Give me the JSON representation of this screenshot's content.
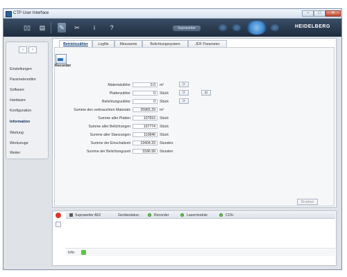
{
  "window": {
    "title": "CTP User Interface"
  },
  "window_controls": {
    "minimize": "–",
    "maximize": "□",
    "close": "✕"
  },
  "toolbar": {
    "device_label": "Suprasetter",
    "brand": "HEIDELBERG",
    "icons": [
      "pages-icon",
      "print-icon",
      "wrench-icon",
      "tools-icon",
      "info-icon",
      "help-icon"
    ]
  },
  "sidebar": {
    "nav_back": "‹",
    "nav_forward": "›",
    "items": [
      {
        "label": "Einstellungen",
        "active": false
      },
      {
        "label": "Parametereditor",
        "active": false
      },
      {
        "label": "Software",
        "active": false
      },
      {
        "label": "Hardware",
        "active": false
      },
      {
        "label": "Konfiguration",
        "active": false
      },
      {
        "label": "Information",
        "active": true
      },
      {
        "label": "Wartung",
        "active": false
      },
      {
        "label": "Werkzeuge",
        "active": false
      },
      {
        "label": "Weiter",
        "active": false
      }
    ]
  },
  "tabs": [
    {
      "label": "Betriebszähler",
      "active": true
    },
    {
      "label": "Logfile",
      "active": false
    },
    {
      "label": "Messwerte",
      "active": false
    },
    {
      "label": "Belichtungssystem",
      "active": false
    },
    {
      "label": "JDF Parameter",
      "active": false
    }
  ],
  "recorder": {
    "label": "Recorder",
    "rows": [
      {
        "label": "Materialzähler",
        "value": "0.0",
        "unit": "m²"
      },
      {
        "label": "Plattenzähler",
        "value": "0",
        "unit": "Stück"
      },
      {
        "label": "Belichtungszähler",
        "value": "0",
        "unit": "Stück"
      },
      {
        "label": "Summe des verbrauchten Materials",
        "value": "25965.29",
        "unit": "m²"
      },
      {
        "label": "Summe aller Platten",
        "value": "107816",
        "unit": "Stück"
      },
      {
        "label": "Summe aller Belichtungen",
        "value": "107774",
        "unit": "Stück"
      },
      {
        "label": "Summe aller Stanzungen",
        "value": "110846",
        "unit": "Stück"
      },
      {
        "label": "Summe der Einschaltzeit",
        "value": "19404.33",
        "unit": "Stunden"
      },
      {
        "label": "Summe der Belichtungszeit",
        "value": "3186.99",
        "unit": "Stunden"
      }
    ]
  },
  "print_button": "Drucken",
  "status": {
    "device": "Suprasetter A52",
    "device_status_label": "Gerätestatus:",
    "indicators": [
      {
        "label": "Recorder",
        "color": "#5dc43e"
      },
      {
        "label": "Lasermodule",
        "color": "#5dc43e"
      },
      {
        "label": "COU",
        "color": "#5dc43e"
      }
    ],
    "info_label": "Info:"
  }
}
